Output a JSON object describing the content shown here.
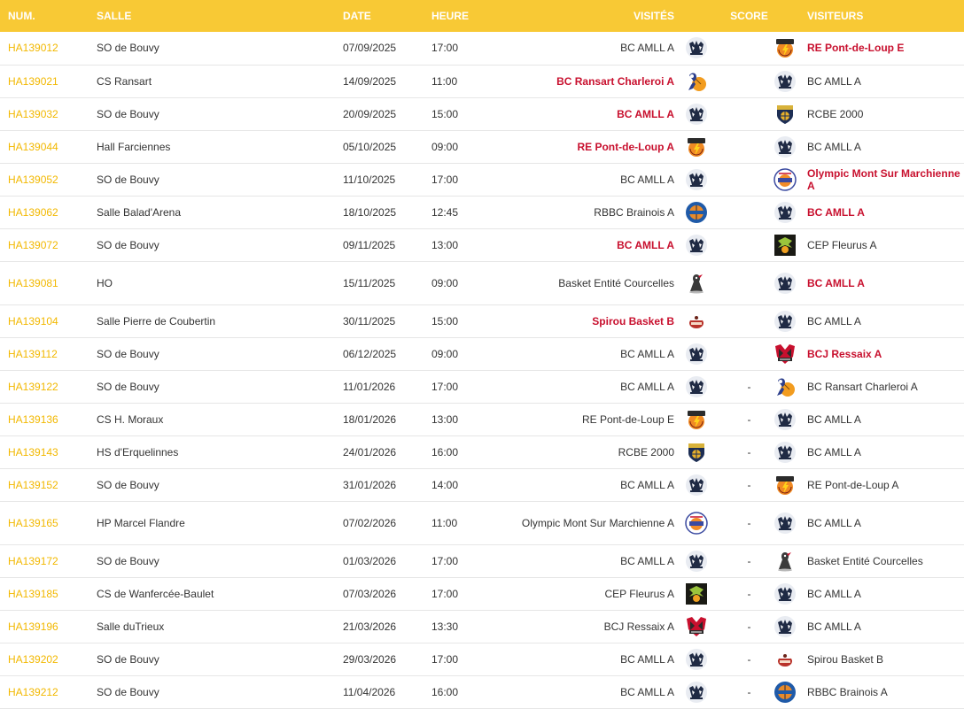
{
  "headers": {
    "num": "NUM.",
    "salle": "SALLE",
    "date": "DATE",
    "heure": "HEURE",
    "visites": "VISITÉS",
    "score": "SCORE",
    "visiteurs": "VISITEURS"
  },
  "colors": {
    "header_bg": "#f8c935",
    "match_number": "#f2b800",
    "winner": "#c8102e"
  },
  "matches": [
    {
      "num": "HA139012",
      "salle": "SO de Bouvy",
      "date": "07/09/2025",
      "heure": "17:00",
      "home": "BC AMLL A",
      "home_logo": "amll-logo",
      "home_win": false,
      "score": "",
      "away": "RE Pont-de-Loup E",
      "away_logo": "eclairs-logo",
      "away_win": true
    },
    {
      "num": "HA139021",
      "salle": "CS Ransart",
      "date": "14/09/2025",
      "heure": "11:00",
      "home": "BC Ransart Charleroi A",
      "home_logo": "ransart-logo",
      "home_win": true,
      "score": "",
      "away": "BC AMLL A",
      "away_logo": "amll-logo",
      "away_win": false
    },
    {
      "num": "HA139032",
      "salle": "SO de Bouvy",
      "date": "20/09/2025",
      "heure": "15:00",
      "home": "BC AMLL A",
      "home_logo": "amll-logo",
      "home_win": true,
      "score": "",
      "away": "RCBE 2000",
      "away_logo": "rcbe-logo",
      "away_win": false
    },
    {
      "num": "HA139044",
      "salle": "Hall Farciennes",
      "date": "05/10/2025",
      "heure": "09:00",
      "home": "RE Pont-de-Loup A",
      "home_logo": "eclairs-logo",
      "home_win": true,
      "score": "",
      "away": "BC AMLL A",
      "away_logo": "amll-logo",
      "away_win": false
    },
    {
      "num": "HA139052",
      "salle": "SO de Bouvy",
      "date": "11/10/2025",
      "heure": "17:00",
      "home": "BC AMLL A",
      "home_logo": "amll-logo",
      "home_win": false,
      "score": "",
      "away": "Olympic Mont Sur Marchienne A",
      "away_logo": "olympic-logo",
      "away_win": true
    },
    {
      "num": "HA139062",
      "salle": "Salle Balad'Arena",
      "date": "18/10/2025",
      "heure": "12:45",
      "home": "RBBC Brainois A",
      "home_logo": "brainois-logo",
      "home_win": false,
      "score": "",
      "away": "BC AMLL A",
      "away_logo": "amll-logo",
      "away_win": true
    },
    {
      "num": "HA139072",
      "salle": "SO de Bouvy",
      "date": "09/11/2025",
      "heure": "13:00",
      "home": "BC AMLL A",
      "home_logo": "amll-logo",
      "home_win": true,
      "score": "",
      "away": "CEP Fleurus A",
      "away_logo": "fleurus-logo",
      "away_win": false
    },
    {
      "num": "HA139081",
      "salle": "HO",
      "date": "15/11/2025",
      "heure": "09:00",
      "home": "Basket Entité Courcelles",
      "home_logo": "courcelles-logo",
      "home_win": false,
      "score": "",
      "away": "BC AMLL A",
      "away_logo": "amll-logo",
      "away_win": true,
      "tall": true
    },
    {
      "num": "HA139104",
      "salle": "Salle Pierre de Coubertin",
      "date": "30/11/2025",
      "heure": "15:00",
      "home": "Spirou Basket B",
      "home_logo": "spirou-logo",
      "home_win": true,
      "score": "",
      "away": "BC AMLL A",
      "away_logo": "amll-logo",
      "away_win": false
    },
    {
      "num": "HA139112",
      "salle": "SO de Bouvy",
      "date": "06/12/2025",
      "heure": "09:00",
      "home": "BC AMLL A",
      "home_logo": "amll-logo",
      "home_win": false,
      "score": "",
      "away": "BCJ Ressaix A",
      "away_logo": "ressaix-logo",
      "away_win": true
    },
    {
      "num": "HA139122",
      "salle": "SO de Bouvy",
      "date": "11/01/2026",
      "heure": "17:00",
      "home": "BC AMLL A",
      "home_logo": "amll-logo",
      "home_win": false,
      "score": "-",
      "away": "BC Ransart Charleroi A",
      "away_logo": "ransart-logo",
      "away_win": false
    },
    {
      "num": "HA139136",
      "salle": "CS H. Moraux",
      "date": "18/01/2026",
      "heure": "13:00",
      "home": "RE Pont-de-Loup E",
      "home_logo": "eclairs-logo",
      "home_win": false,
      "score": "-",
      "away": "BC AMLL A",
      "away_logo": "amll-logo",
      "away_win": false
    },
    {
      "num": "HA139143",
      "salle": "HS d'Erquelinnes",
      "date": "24/01/2026",
      "heure": "16:00",
      "home": "RCBE 2000",
      "home_logo": "rcbe-logo",
      "home_win": false,
      "score": "-",
      "away": "BC AMLL A",
      "away_logo": "amll-logo",
      "away_win": false
    },
    {
      "num": "HA139152",
      "salle": "SO de Bouvy",
      "date": "31/01/2026",
      "heure": "14:00",
      "home": "BC AMLL A",
      "home_logo": "amll-logo",
      "home_win": false,
      "score": "-",
      "away": "RE Pont-de-Loup A",
      "away_logo": "eclairs-logo",
      "away_win": false
    },
    {
      "num": "HA139165",
      "salle": "HP Marcel Flandre",
      "date": "07/02/2026",
      "heure": "11:00",
      "home": "Olympic Mont Sur Marchienne A",
      "home_logo": "olympic-logo",
      "home_win": false,
      "score": "-",
      "away": "BC AMLL A",
      "away_logo": "amll-logo",
      "away_win": false,
      "tall": true
    },
    {
      "num": "HA139172",
      "salle": "SO de Bouvy",
      "date": "01/03/2026",
      "heure": "17:00",
      "home": "BC AMLL A",
      "home_logo": "amll-logo",
      "home_win": false,
      "score": "-",
      "away": "Basket Entité Courcelles",
      "away_logo": "courcelles-logo",
      "away_win": false
    },
    {
      "num": "HA139185",
      "salle": "CS de Wanfercée-Baulet",
      "date": "07/03/2026",
      "heure": "17:00",
      "home": "CEP Fleurus A",
      "home_logo": "fleurus-logo",
      "home_win": false,
      "score": "-",
      "away": "BC AMLL A",
      "away_logo": "amll-logo",
      "away_win": false
    },
    {
      "num": "HA139196",
      "salle": "Salle duTrieux",
      "date": "21/03/2026",
      "heure": "13:30",
      "home": "BCJ Ressaix A",
      "home_logo": "ressaix-logo",
      "home_win": false,
      "score": "-",
      "away": "BC AMLL A",
      "away_logo": "amll-logo",
      "away_win": false
    },
    {
      "num": "HA139202",
      "salle": "SO de Bouvy",
      "date": "29/03/2026",
      "heure": "17:00",
      "home": "BC AMLL A",
      "home_logo": "amll-logo",
      "home_win": false,
      "score": "-",
      "away": "Spirou Basket B",
      "away_logo": "spirou-logo",
      "away_win": false
    },
    {
      "num": "HA139212",
      "salle": "SO de Bouvy",
      "date": "11/04/2026",
      "heure": "16:00",
      "home": "BC AMLL A",
      "home_logo": "amll-logo",
      "home_win": false,
      "score": "-",
      "away": "RBBC Brainois A",
      "away_logo": "brainois-logo",
      "away_win": false
    }
  ]
}
